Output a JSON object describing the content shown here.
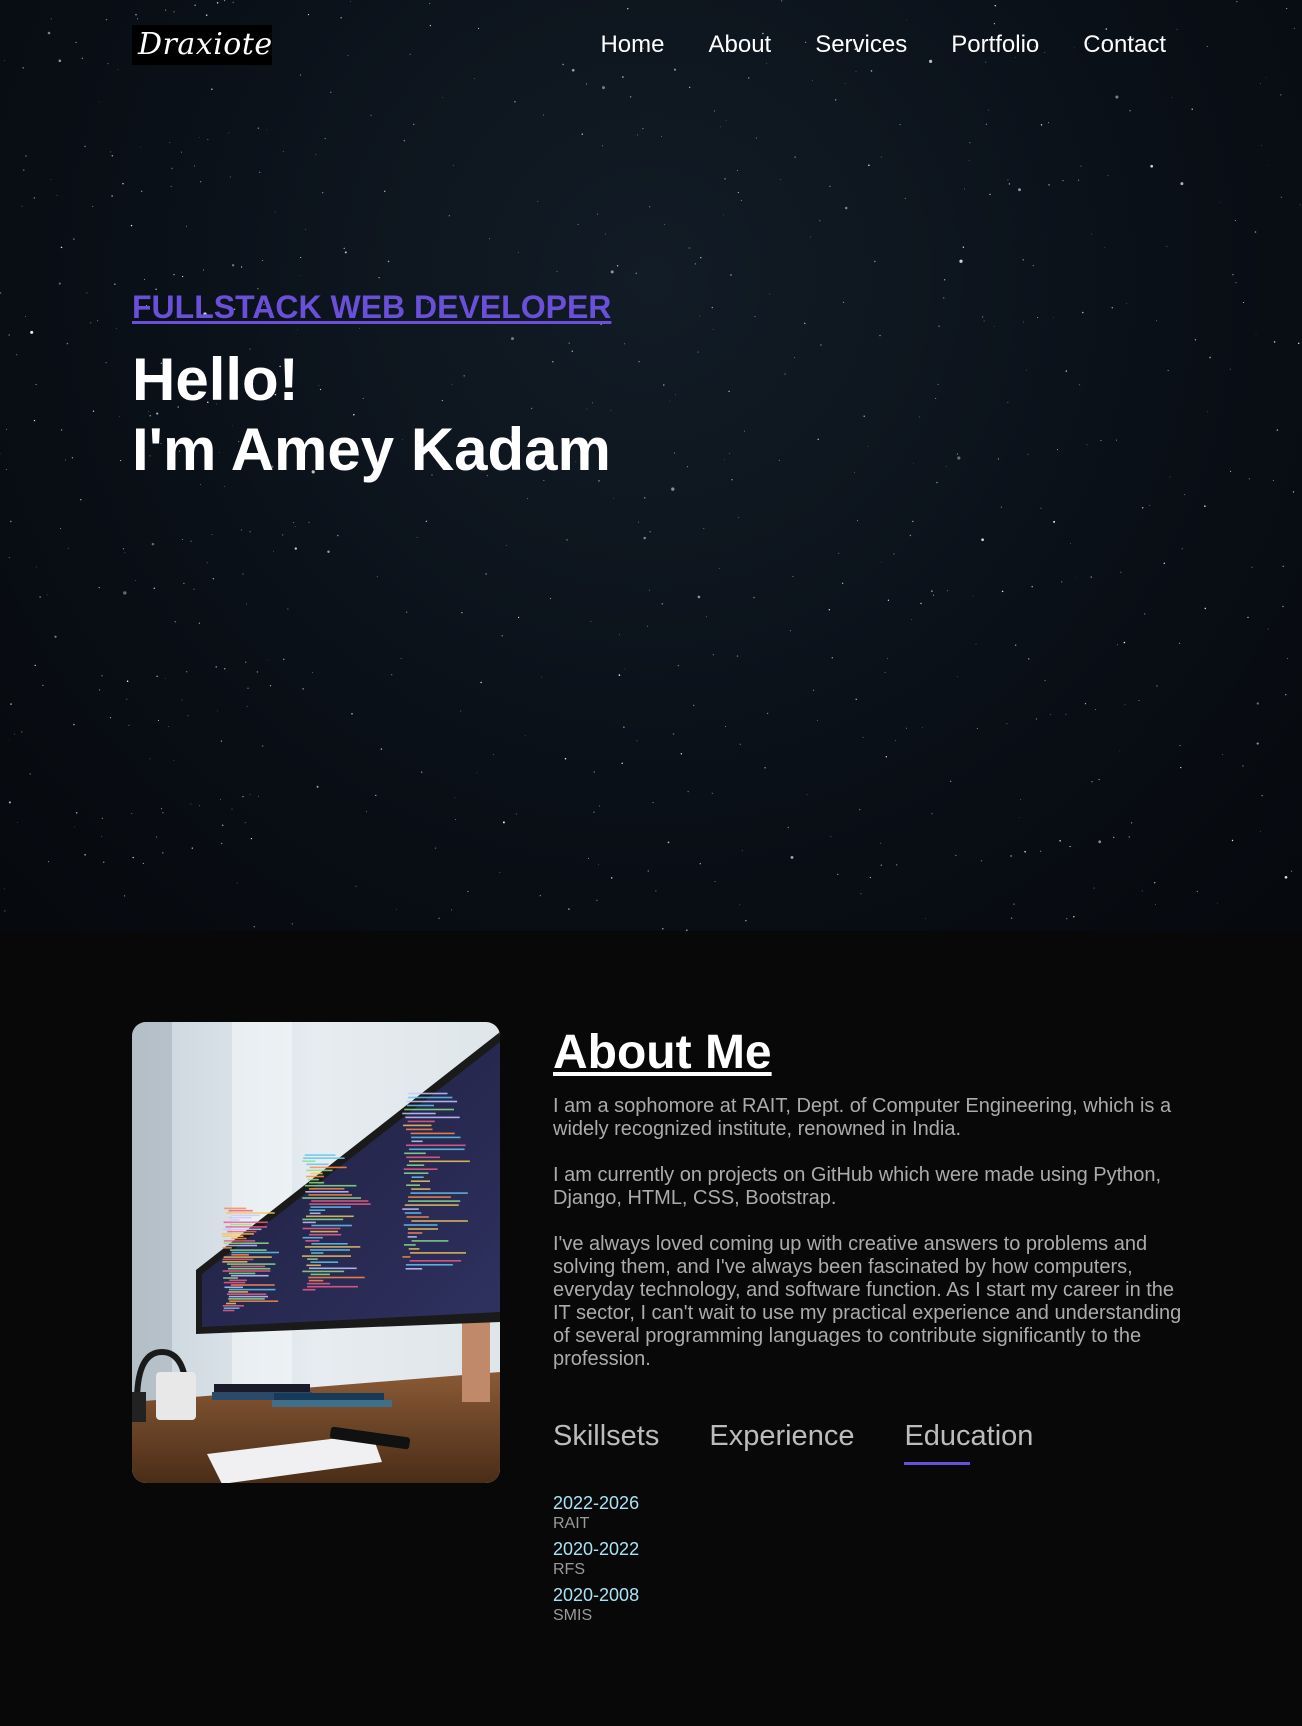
{
  "brand": {
    "logo_text": "Draxiote"
  },
  "nav": {
    "items": [
      {
        "label": "Home"
      },
      {
        "label": "About"
      },
      {
        "label": "Services"
      },
      {
        "label": "Portfolio"
      },
      {
        "label": "Contact"
      }
    ]
  },
  "hero": {
    "subtitle": "FULLSTACK WEB DEVELOPER",
    "greeting": "Hello!",
    "name_line": "I'm Amey Kadam"
  },
  "about": {
    "heading": "About Me",
    "paragraphs": [
      "I am a sophomore at RAIT, Dept. of Computer Engineering, which is a widely recognized institute, renowned in India.",
      "I am currently on projects on GitHub which were made using Python, Django, HTML, CSS, Bootstrap.",
      "I've always loved coming up with creative answers to problems and solving them, and I've always been fascinated by how computers, everyday technology, and software function. As I start my career in the IT sector, I can't wait to use my practical experience and understanding of several programming languages to contribute significantly to the profession."
    ],
    "tabs": [
      {
        "label": "Skillsets",
        "active": false
      },
      {
        "label": "Experience",
        "active": false
      },
      {
        "label": "Education",
        "active": true
      }
    ],
    "education": [
      {
        "years": "2022-2026",
        "school": "RAIT"
      },
      {
        "years": "2020-2022",
        "school": "RFS"
      },
      {
        "years": "2020-2008",
        "school": "SMIS"
      }
    ]
  },
  "colors": {
    "accent": "#6a4fd9",
    "year_text": "#a8e3f5",
    "page_bg": "#080808"
  }
}
